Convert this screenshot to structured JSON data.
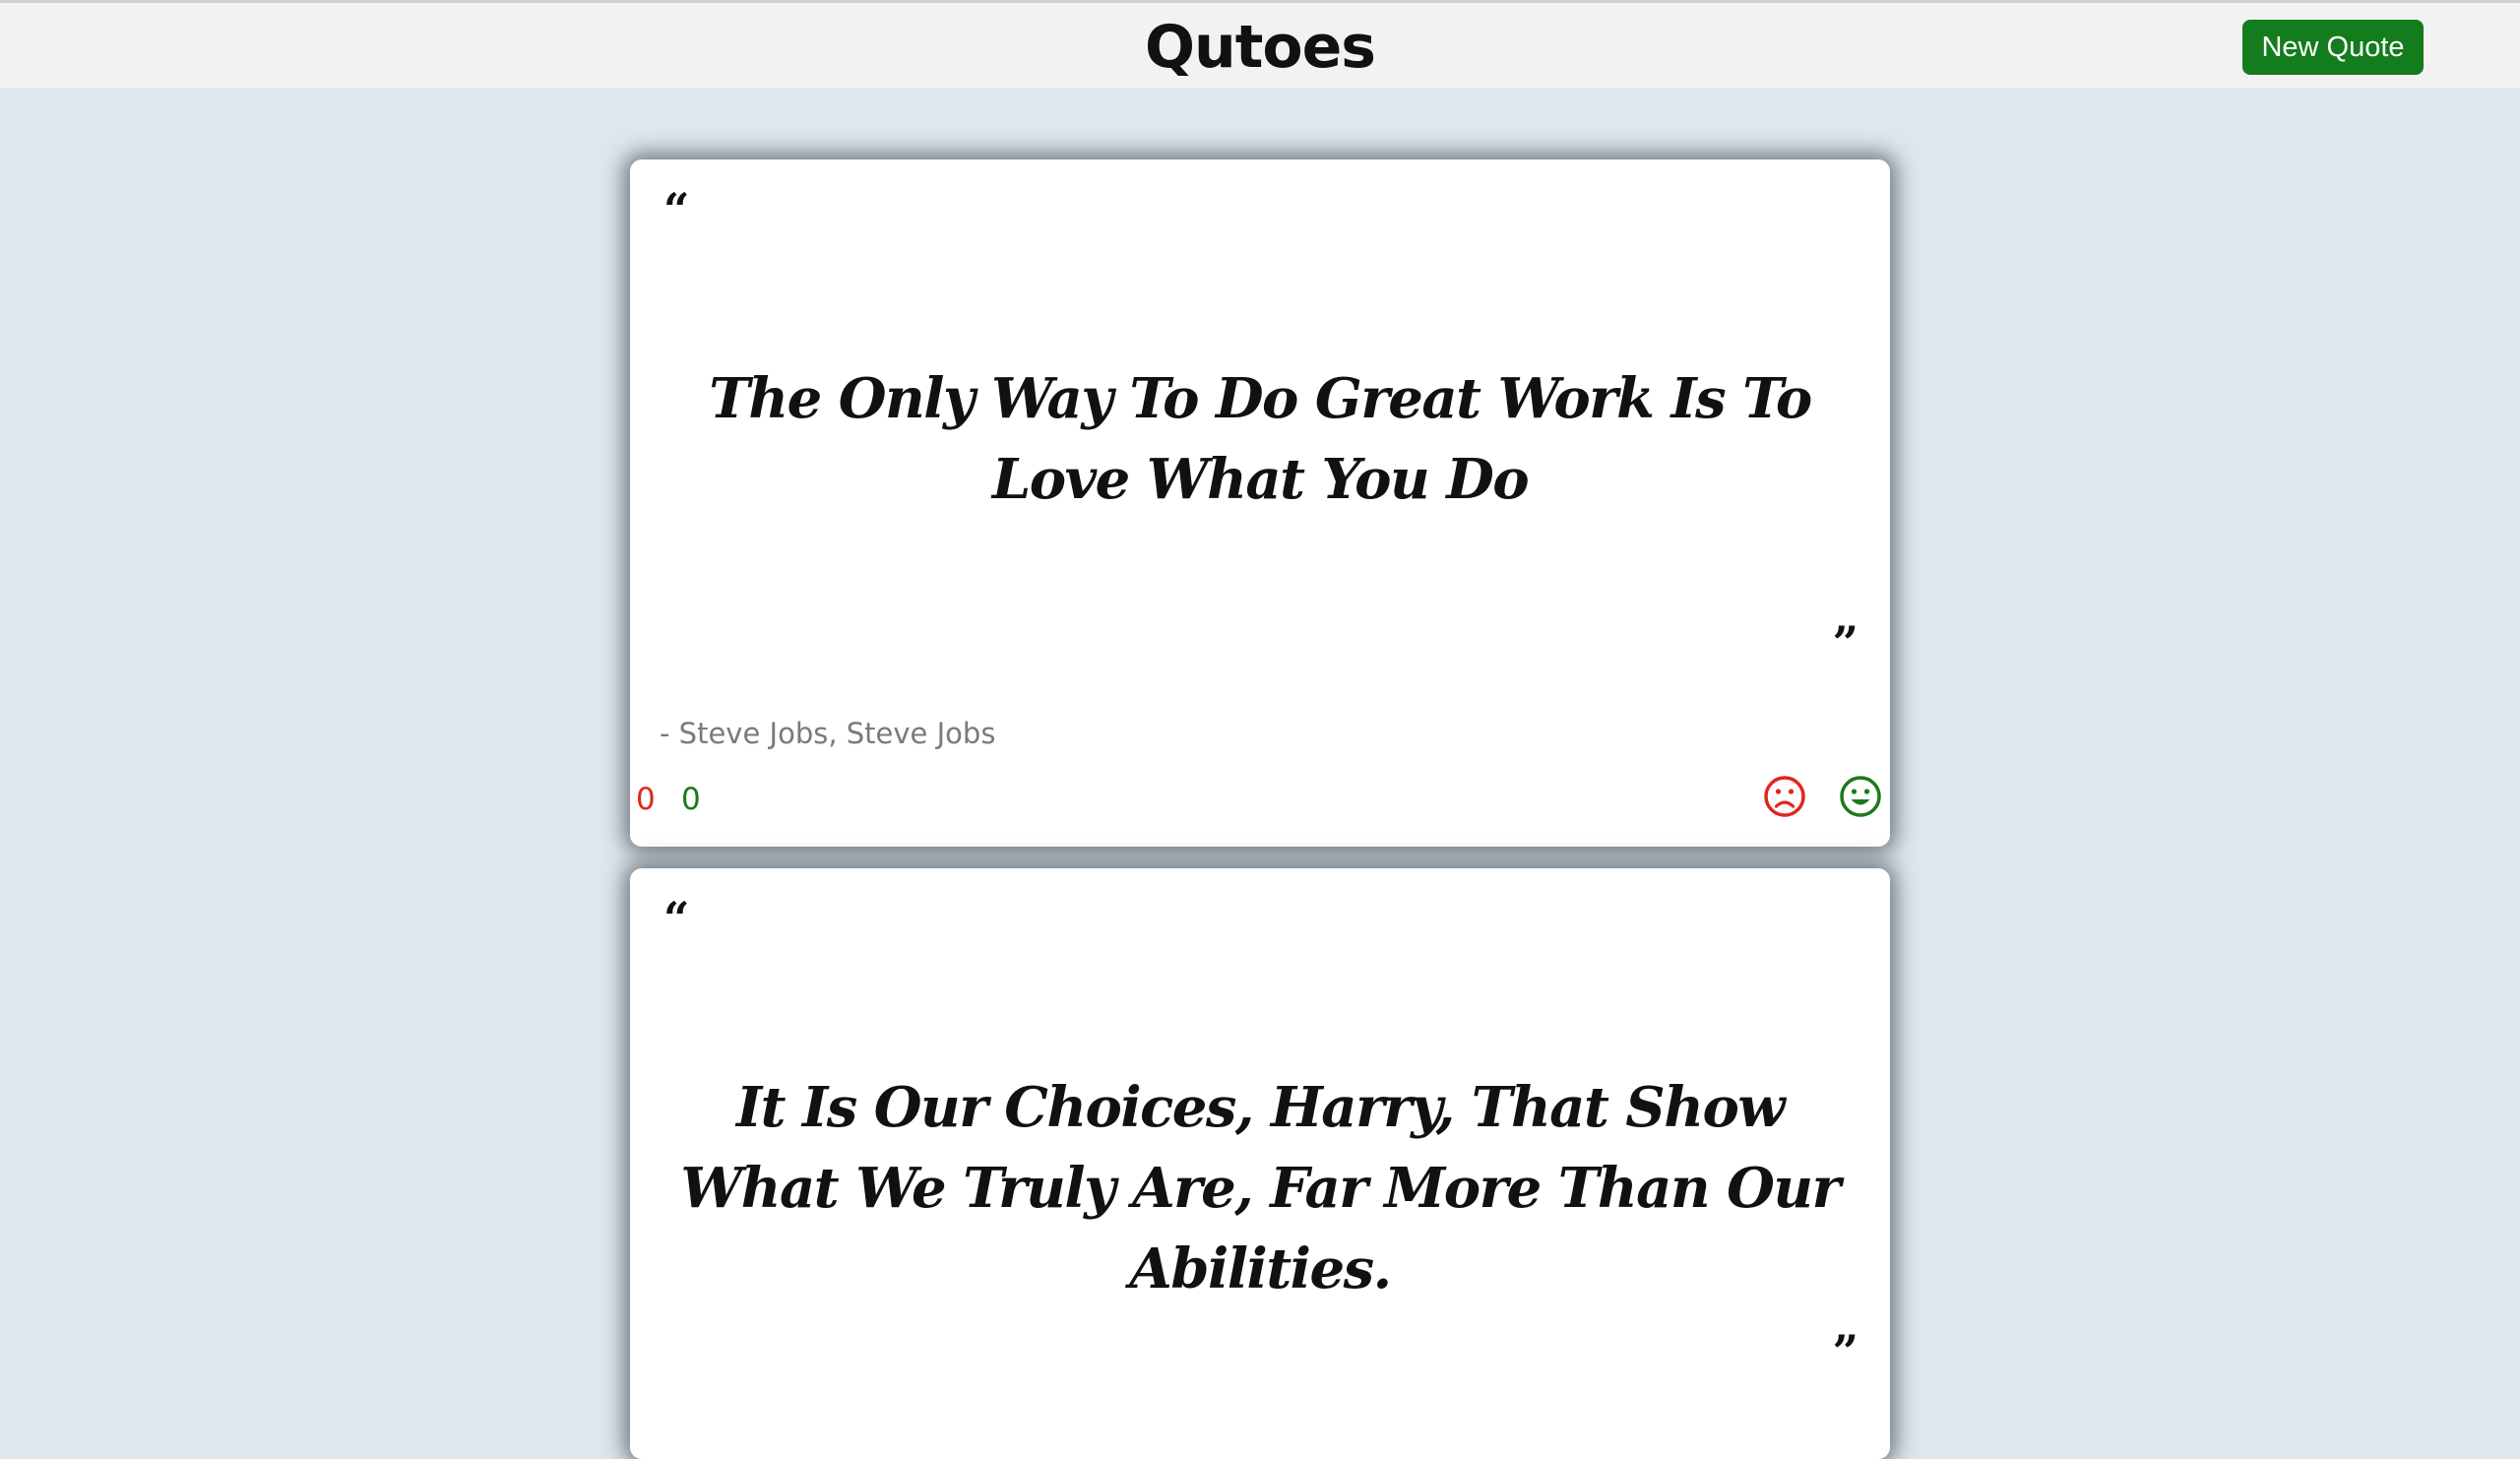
{
  "header": {
    "title": "Qutoes",
    "new_quote_label": "New Quote"
  },
  "quotes": [
    {
      "open_mark": "“",
      "text": "The Only Way To Do Great Work Is To Love What You Do",
      "close_mark": "”",
      "author": "- Steve Jobs, Steve Jobs",
      "dislikes": "0",
      "likes": "0",
      "dislike_icon": "sad-face-icon",
      "like_icon": "smiley-face-icon"
    },
    {
      "open_mark": "“",
      "text": "It Is Our Choices, Harry, That Show What We Truly Are, Far More Than Our Abilities.",
      "close_mark": "”"
    }
  ],
  "colors": {
    "page_background": "#dfe6ed",
    "header_background": "#f2f2f2",
    "button_green": "#137c1c",
    "dislike_red": "#e0261b",
    "like_green": "#1b7a1b",
    "author_gray": "#7a7a7a"
  }
}
